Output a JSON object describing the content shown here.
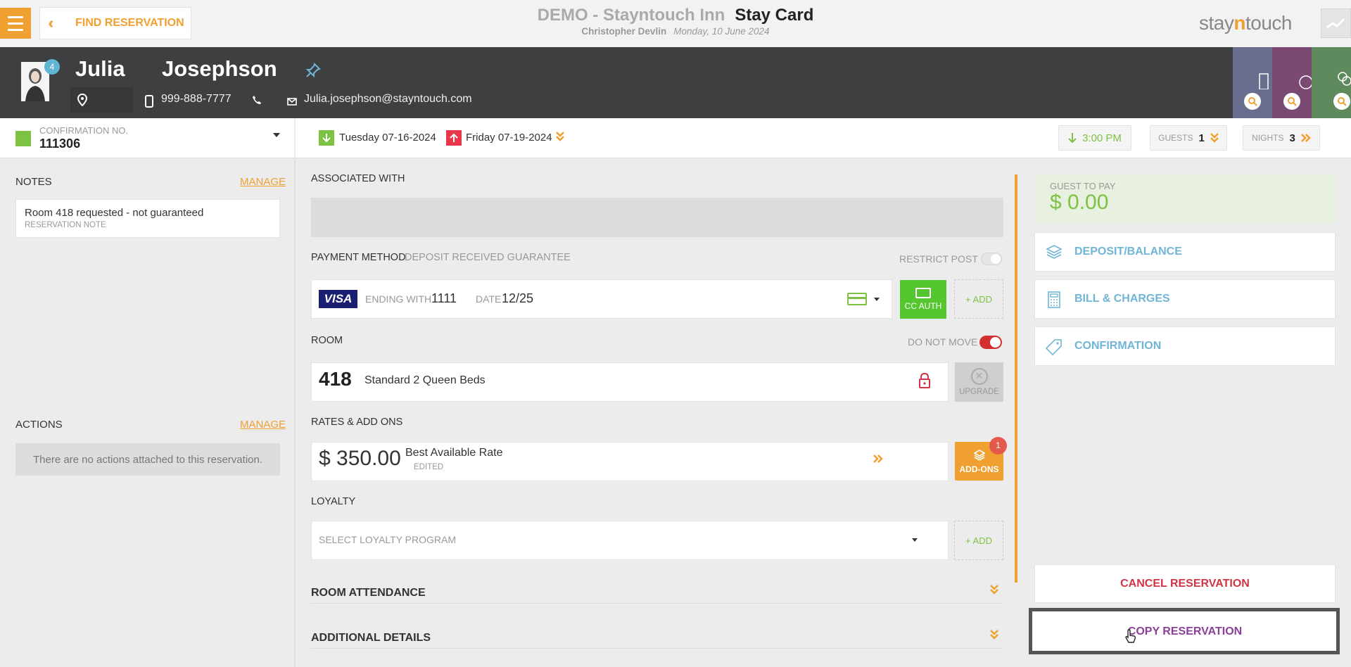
{
  "header": {
    "find_reservation": "FIND RESERVATION",
    "hotel": "DEMO - Stayntouch Inn",
    "page": "Stay Card",
    "user": "Christopher Devlin",
    "date": "Monday, 10 June 2024",
    "logo_pre": "stay",
    "logo_n": "n",
    "logo_post": "touch"
  },
  "guest": {
    "first_name": "Julia",
    "last_name": "Josephson",
    "badge": "4",
    "phone": "999-888-7777",
    "email": "Julia.josephson@stayntouch.com"
  },
  "reservation": {
    "confirmation_label": "CONFIRMATION NO.",
    "confirmation_number": "111306",
    "arrival": "Tuesday 07-16-2024",
    "departure": "Friday 07-19-2024",
    "arrival_time": "3:00 PM",
    "guests_label": "GUESTS",
    "guests": "1",
    "nights_label": "NIGHTS",
    "nights": "3"
  },
  "notes": {
    "title": "NOTES",
    "manage": "MANAGE",
    "items": [
      {
        "text": "Room 418 requested - not guaranteed",
        "type": "RESERVATION NOTE"
      }
    ]
  },
  "actions": {
    "title": "ACTIONS",
    "manage": "MANAGE",
    "empty": "There are no actions attached to this reservation."
  },
  "main": {
    "associated_label": "ASSOCIATED WITH",
    "payment_label": "PAYMENT METHOD",
    "payment_sub": "DEPOSIT RECEIVED GUARANTEE",
    "restrict_post": "RESTRICT POST",
    "card_brand": "VISA",
    "ending_label": "ENDING WITH",
    "ending_value": "1111",
    "date_label": "DATE",
    "date_value": "12/25",
    "cc_auth": "CC AUTH",
    "add": "+ ADD",
    "room_label": "ROOM",
    "do_not_move": "DO NOT MOVE",
    "room_number": "418",
    "room_type": "Standard 2 Queen Beds",
    "upgrade": "UPGRADE",
    "rates_label": "RATES & ADD ONS",
    "rate_amount": "$ 350.00",
    "rate_name": "Best Available Rate",
    "rate_edited": "EDITED",
    "addons": "ADD-ONS",
    "addons_count": "1",
    "loyalty_label": "LOYALTY",
    "loyalty_placeholder": "SELECT LOYALTY PROGRAM",
    "room_attendance": "ROOM ATTENDANCE",
    "additional_details": "ADDITIONAL DETAILS"
  },
  "sidebar": {
    "guest_to_pay_label": "GUEST TO PAY",
    "guest_to_pay_value": "$ 0.00",
    "deposit_balance": "DEPOSIT/BALANCE",
    "bill_charges": "BILL & CHARGES",
    "confirmation": "CONFIRMATION",
    "cancel": "CANCEL RESERVATION",
    "copy": "COPY RESERVATION"
  },
  "colors": {
    "accent": "#f0a030",
    "green": "#7dc243",
    "red": "#d03545",
    "blue": "#70b5d6",
    "purple": "#8b3f9a"
  },
  "icons": [
    "menu-icon",
    "double-chevron-left-icon",
    "pin-icon",
    "location-icon",
    "phone-icon",
    "mail-icon",
    "search-icon",
    "lock-icon",
    "card-icon",
    "stack-icon",
    "calculator-icon",
    "tag-icon",
    "cursor-icon"
  ]
}
